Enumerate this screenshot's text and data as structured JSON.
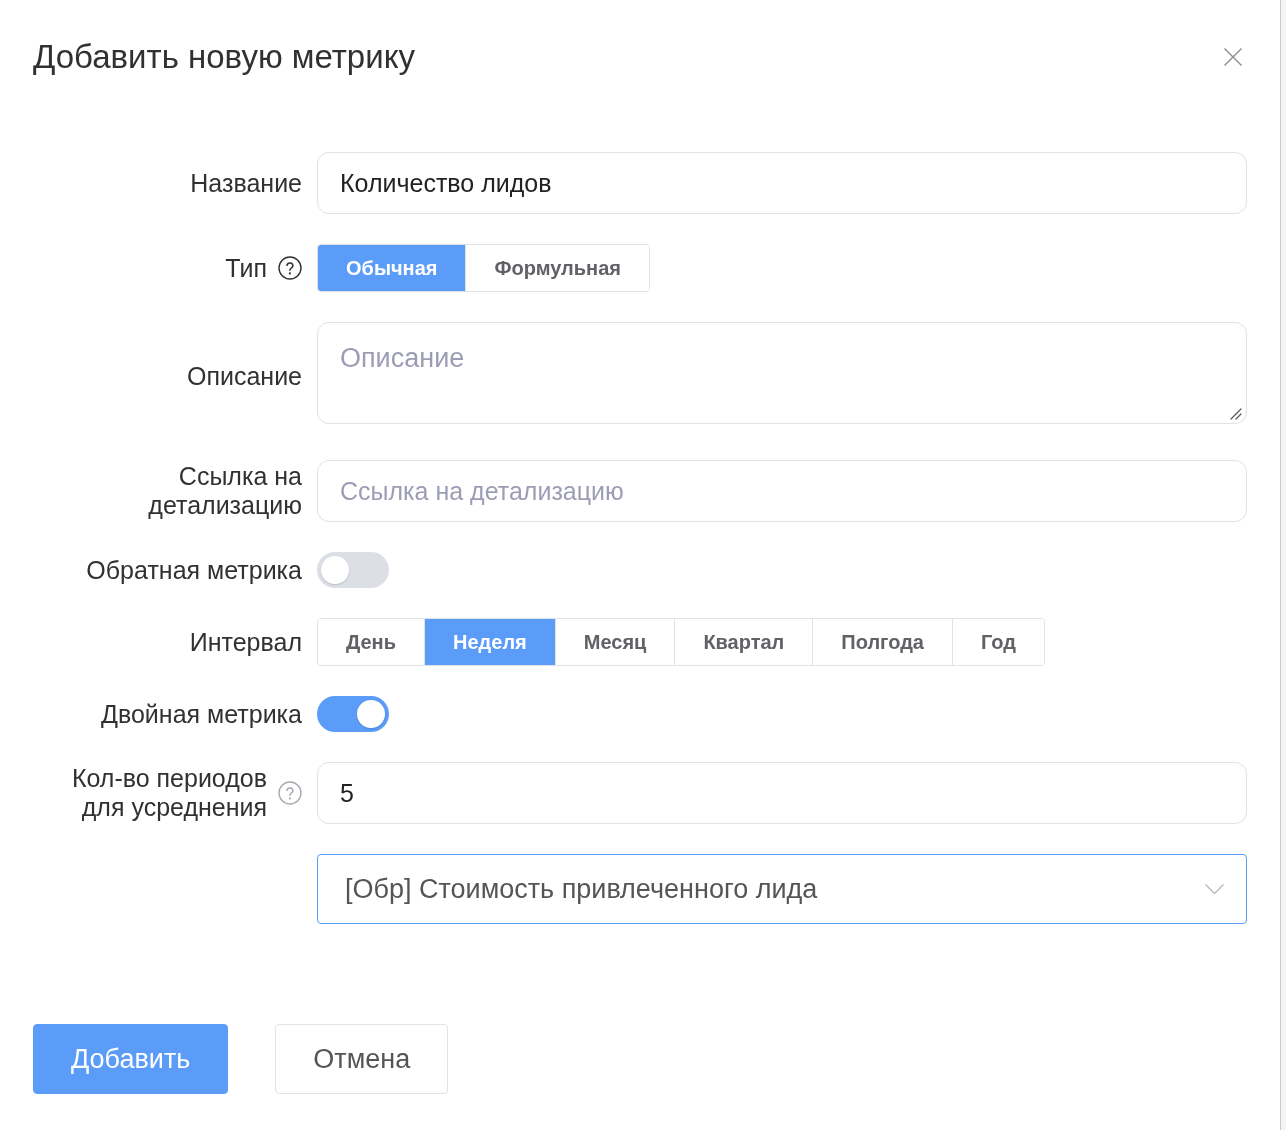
{
  "dialog": {
    "title": "Добавить новую метрику"
  },
  "fields": [
    {
      "kind": "text",
      "label": "Название",
      "value": "Количество лидов"
    },
    {
      "kind": "segmented",
      "label": "Тип",
      "help": true,
      "help_muted": false,
      "options": [
        {
          "label": "Обычная",
          "selected": true
        },
        {
          "label": "Формульная",
          "selected": false
        }
      ]
    },
    {
      "kind": "textarea",
      "label": "Описание",
      "placeholder": "Описание"
    },
    {
      "kind": "text",
      "label": "Ссылка на детализацию",
      "placeholder": "Ссылка на детализацию"
    },
    {
      "kind": "toggle",
      "label": "Обратная метрика",
      "on": false
    },
    {
      "kind": "segmented",
      "label": "Интервал",
      "options": [
        {
          "label": "День",
          "selected": false
        },
        {
          "label": "Неделя",
          "selected": true
        },
        {
          "label": "Месяц",
          "selected": false
        },
        {
          "label": "Квартал",
          "selected": false
        },
        {
          "label": "Полгода",
          "selected": false
        },
        {
          "label": "Год",
          "selected": false
        }
      ]
    },
    {
      "kind": "toggle",
      "label": "Двойная метрика",
      "on": true
    },
    {
      "kind": "text",
      "label": "Кол-во периодов для усреднения",
      "help": true,
      "help_muted": true,
      "value": "5"
    },
    {
      "kind": "select",
      "value": "[Обр] Стоимость привлеченного лида",
      "focused": true
    }
  ],
  "buttons": [
    {
      "label": "Добавить",
      "primary": true
    },
    {
      "label": "Отмена",
      "primary": false
    }
  ]
}
